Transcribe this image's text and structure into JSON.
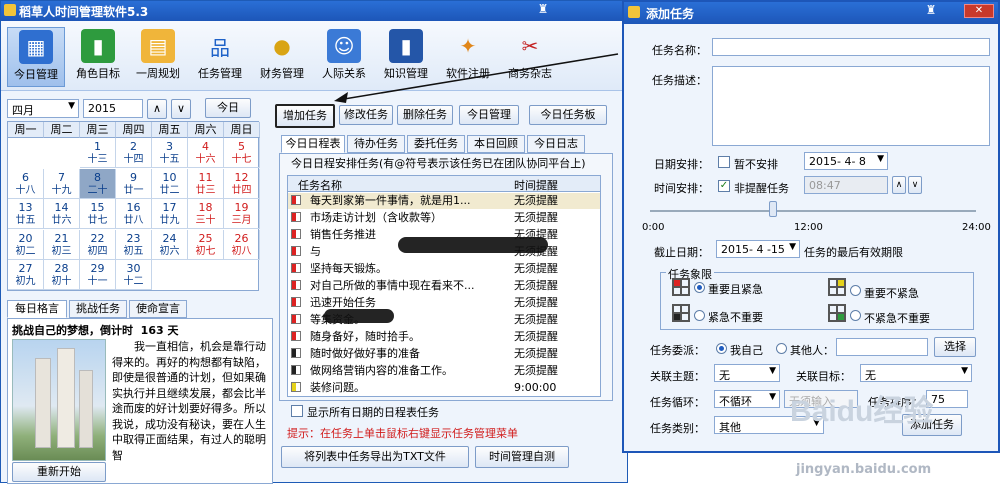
{
  "main": {
    "title": "稻草人时间管理软件5.3",
    "toolbar": [
      {
        "label": "今日管理",
        "icon": "calendar-icon"
      },
      {
        "label": "角色目标",
        "icon": "book-green-icon"
      },
      {
        "label": "一周规划",
        "icon": "cards-icon"
      },
      {
        "label": "任务管理",
        "icon": "org-chart-icon"
      },
      {
        "label": "财务管理",
        "icon": "coins-icon"
      },
      {
        "label": "人际关系",
        "icon": "contact-card-icon"
      },
      {
        "label": "知识管理",
        "icon": "book-blue-icon"
      },
      {
        "label": "软件注册",
        "icon": "magic-wand-icon"
      },
      {
        "label": "商务杂志",
        "icon": "scissors-icon"
      }
    ],
    "calendar": {
      "month": "四月",
      "year": "2015",
      "up": "∧",
      "down": "∨",
      "today_btn": "今日",
      "weekdays": [
        "周一",
        "周二",
        "周三",
        "周四",
        "周五",
        "周六",
        "周日"
      ],
      "cells": [
        {
          "n": "1",
          "l": "十三",
          "col": 2,
          "row": 0
        },
        {
          "n": "2",
          "l": "十四",
          "col": 3,
          "row": 0
        },
        {
          "n": "3",
          "l": "十五",
          "col": 4,
          "row": 0
        },
        {
          "n": "4",
          "l": "十六",
          "col": 5,
          "row": 0,
          "red": true
        },
        {
          "n": "5",
          "l": "十七",
          "col": 6,
          "row": 0,
          "red": true
        },
        {
          "n": "6",
          "l": "十八",
          "col": 0,
          "row": 1
        },
        {
          "n": "7",
          "l": "十九",
          "col": 1,
          "row": 1
        },
        {
          "n": "8",
          "l": "二十",
          "col": 2,
          "row": 1,
          "today": true
        },
        {
          "n": "9",
          "l": "廿一",
          "col": 3,
          "row": 1
        },
        {
          "n": "10",
          "l": "廿二",
          "col": 4,
          "row": 1
        },
        {
          "n": "11",
          "l": "廿三",
          "col": 5,
          "row": 1,
          "red": true
        },
        {
          "n": "12",
          "l": "廿四",
          "col": 6,
          "row": 1,
          "red": true
        },
        {
          "n": "13",
          "l": "廿五",
          "col": 0,
          "row": 2
        },
        {
          "n": "14",
          "l": "廿六",
          "col": 1,
          "row": 2
        },
        {
          "n": "15",
          "l": "廿七",
          "col": 2,
          "row": 2
        },
        {
          "n": "16",
          "l": "廿八",
          "col": 3,
          "row": 2
        },
        {
          "n": "17",
          "l": "廿九",
          "col": 4,
          "row": 2
        },
        {
          "n": "18",
          "l": "三十",
          "col": 5,
          "row": 2,
          "red": true
        },
        {
          "n": "19",
          "l": "三月",
          "col": 6,
          "row": 2,
          "red": true
        },
        {
          "n": "20",
          "l": "初二",
          "col": 0,
          "row": 3
        },
        {
          "n": "21",
          "l": "初三",
          "col": 1,
          "row": 3
        },
        {
          "n": "22",
          "l": "初四",
          "col": 2,
          "row": 3
        },
        {
          "n": "23",
          "l": "初五",
          "col": 3,
          "row": 3
        },
        {
          "n": "24",
          "l": "初六",
          "col": 4,
          "row": 3
        },
        {
          "n": "25",
          "l": "初七",
          "col": 5,
          "row": 3,
          "red": true
        },
        {
          "n": "26",
          "l": "初八",
          "col": 6,
          "row": 3,
          "red": true
        },
        {
          "n": "27",
          "l": "初九",
          "col": 0,
          "row": 4
        },
        {
          "n": "28",
          "l": "初十",
          "col": 1,
          "row": 4
        },
        {
          "n": "29",
          "l": "十一",
          "col": 2,
          "row": 4
        },
        {
          "n": "30",
          "l": "十二",
          "col": 3,
          "row": 4
        }
      ]
    },
    "left_tabs": [
      "每日格言",
      "挑战任务",
      "使命宣言"
    ],
    "challenge": "挑战自己的梦想，倒计时",
    "countdown": "163 天",
    "quote": "我一直相信，机会是靠行动得来的。再好的构想都有缺陷，即使是很普通的计划，但如果确实执行并且继续发展，都会比半途而废的好计划要好得多。所以我说，成功没有秘诀，要在人生中取得正面结果，有过人的聪明智",
    "restart_btn": "重新开始",
    "task_buttons": [
      "增加任务",
      "修改任务",
      "删除任务",
      "今日管理",
      "今日任务板"
    ],
    "task_tabs": [
      "今日日程表",
      "待办任务",
      "委托任务",
      "本日回顾",
      "今日日志"
    ],
    "group_title": "今日日程安排任务(有@符号表示该任务已在团队协同平台上)",
    "col_name": "任务名称",
    "col_time": "时间提醒",
    "tasks": [
      {
        "name": "每天到家第一件事情，就是用1...",
        "time": "无须提醒",
        "q": "#d22"
      },
      {
        "name": "市场走访计划（含收款等）",
        "time": "无须提醒",
        "q": "#d22"
      },
      {
        "name": "销售任务推进",
        "time": "无须提醒",
        "q": "#d22"
      },
      {
        "name": "与",
        "time": "无须提醒",
        "q": "#d22"
      },
      {
        "name": "坚持每天锻炼。",
        "time": "无须提醒",
        "q": "#d22"
      },
      {
        "name": "对自己所做的事情中现在看来不...",
        "time": "无须提醒",
        "q": "#d22"
      },
      {
        "name": "迅速开始任务",
        "time": "无须提醒",
        "q": "#d22"
      },
      {
        "name": "等集资金。",
        "time": "无须提醒",
        "q": "#d22"
      },
      {
        "name": "随身备好，随时拾手。",
        "time": "无须提醒",
        "q": "#d22"
      },
      {
        "name": "随时做好做好事的准备",
        "time": "无须提醒",
        "q": "#222"
      },
      {
        "name": "做网络营销内容的准备工作。",
        "time": "无须提醒",
        "q": "#222"
      },
      {
        "name": "装修问题。",
        "time": "9:00:00",
        "q": "#e5d21a"
      }
    ],
    "show_all": "显示所有日期的日程表任务",
    "hint": "提示：在任务上单击鼠标右键显示任务管理菜单",
    "export_btn": "将列表中任务导出为TXT文件",
    "selftest_btn": "时间管理自测"
  },
  "dialog": {
    "title": "添加任务",
    "name_label": "任务名称：",
    "name_value": "",
    "desc_label": "任务描述：",
    "desc_value": "",
    "date_label": "日期安排：",
    "no_arrange": "暂不安排",
    "date_value": "2015- 4- 8",
    "time_label": "时间安排：",
    "no_remind": "非提醒任务",
    "time_value": "08:47",
    "slider_ticks": [
      "0:00",
      "12:00",
      "24:00"
    ],
    "deadline_label": "截止日期：",
    "deadline_value": "2015- 4 -15",
    "deadline_note": "任务的最后有效期限",
    "quadrant_group": "任务象限",
    "quadrants": [
      "重要且紧急",
      "重要不紧急",
      "紧急不重要",
      "不紧急不重要"
    ],
    "delegate_label": "任务委派：",
    "self": "我自己",
    "others": "其他人：",
    "choose_btn": "选择",
    "theme_label": "关联主题：",
    "theme_value": "无",
    "goal_label": "关联目标：",
    "goal_value": "无",
    "cycle_label": "任务循环：",
    "cycle_value": "不循环",
    "cycle_input": "无须输入",
    "order_label": "任务排序：",
    "order_value": "75",
    "category_label": "任务类别：",
    "category_value": "其他",
    "add_btn": "添加任务"
  },
  "watermark": {
    "brand": "Baidu经验",
    "url": "jingyan.baidu.com"
  }
}
